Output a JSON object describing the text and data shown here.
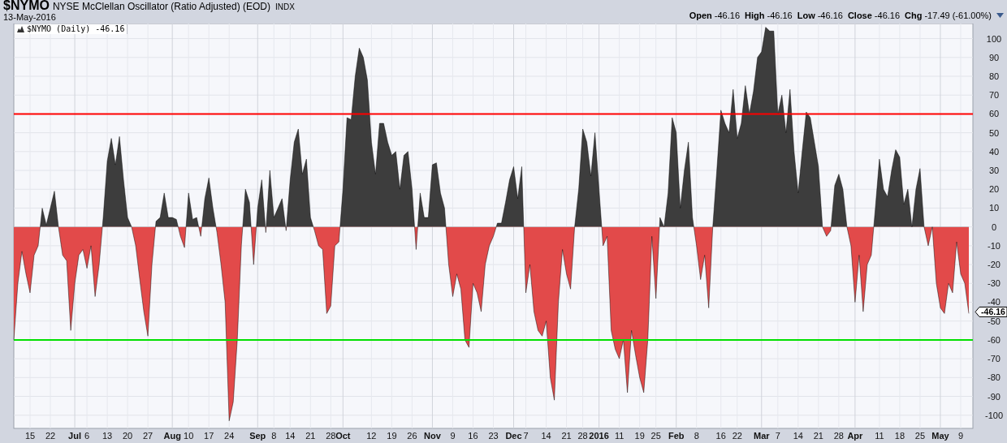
{
  "header": {
    "symbol": "$NYMO",
    "title": "NYSE McClellan Oscillator (Ratio Adjusted) (EOD)",
    "exchange": "INDX",
    "date": "13-May-2016",
    "quote": [
      {
        "label": "Open",
        "value": "-46.16"
      },
      {
        "label": "High",
        "value": "-46.16"
      },
      {
        "label": "Low",
        "value": "-46.16"
      },
      {
        "label": "Close",
        "value": "-46.16"
      },
      {
        "label": "Chg",
        "value": "-17.49 (-61.00%)"
      }
    ]
  },
  "legend": {
    "value": "-46.16"
  },
  "chart": {
    "chart_data": {
      "type": "area",
      "grid": true,
      "ylim": [
        -107,
        108
      ],
      "categories": [
        null,
        null,
        null,
        null,
        "15",
        null,
        null,
        null,
        null,
        "22",
        null,
        null,
        null,
        null,
        null,
        "Jul",
        null,
        null,
        "6",
        null,
        null,
        null,
        null,
        "13",
        null,
        null,
        null,
        null,
        "20",
        null,
        null,
        null,
        null,
        "27",
        null,
        null,
        null,
        null,
        null,
        "Aug",
        null,
        null,
        null,
        "10",
        null,
        null,
        null,
        null,
        "17",
        null,
        null,
        null,
        null,
        "24",
        null,
        null,
        null,
        null,
        null,
        null,
        "Sep",
        null,
        null,
        null,
        "8",
        null,
        null,
        null,
        "14",
        null,
        null,
        null,
        null,
        "21",
        null,
        null,
        null,
        null,
        "28",
        null,
        null,
        "Oct",
        null,
        null,
        null,
        null,
        null,
        null,
        "12",
        null,
        null,
        null,
        null,
        "19",
        null,
        null,
        null,
        null,
        "26",
        null,
        null,
        null,
        null,
        "Nov",
        null,
        null,
        null,
        null,
        "9",
        null,
        null,
        null,
        null,
        "16",
        null,
        null,
        null,
        null,
        "23",
        null,
        null,
        null,
        null,
        "Dec",
        null,
        null,
        "7",
        null,
        null,
        null,
        null,
        "14",
        null,
        null,
        null,
        null,
        "21",
        null,
        null,
        null,
        "28",
        null,
        null,
        null,
        "2016",
        null,
        null,
        null,
        null,
        "11",
        null,
        null,
        null,
        null,
        "19",
        null,
        null,
        null,
        "25",
        null,
        null,
        null,
        null,
        "Feb",
        null,
        null,
        null,
        null,
        "8",
        null,
        null,
        null,
        null,
        null,
        "16",
        null,
        null,
        null,
        "22",
        null,
        null,
        null,
        null,
        null,
        "Mar",
        null,
        null,
        null,
        "7",
        null,
        null,
        null,
        null,
        "14",
        null,
        null,
        null,
        null,
        "21",
        null,
        null,
        null,
        null,
        "28",
        null,
        null,
        null,
        "Apr",
        null,
        null,
        null,
        null,
        null,
        "11",
        null,
        null,
        null,
        null,
        "18",
        null,
        null,
        null,
        null,
        "25",
        null,
        null,
        null,
        null,
        "May",
        null,
        null,
        null,
        null,
        "9",
        null,
        null
      ],
      "yticks": [
        -100,
        -90,
        -80,
        -70,
        -60,
        -50,
        -40,
        -30,
        -20,
        -10,
        0,
        10,
        20,
        30,
        40,
        50,
        60,
        70,
        80,
        90,
        100
      ],
      "series": [
        {
          "name": "$NYMO (Daily)",
          "color": "#000000",
          "values": [
            -60,
            -30,
            -13,
            -25,
            -35,
            -15,
            -10,
            10,
            1,
            10,
            19,
            0,
            -15,
            -18,
            -55,
            -30,
            -15,
            -12,
            -22,
            -10,
            -37,
            -20,
            5,
            35,
            47,
            33,
            48,
            25,
            5,
            0,
            -10,
            -28,
            -45,
            -58,
            -20,
            3,
            5,
            18,
            5,
            5,
            4,
            -5,
            -11,
            18,
            4,
            5,
            -5,
            15,
            26,
            10,
            -3,
            -20,
            -40,
            -103,
            -93,
            -60,
            -10,
            20,
            13,
            -20,
            10,
            25,
            -3,
            30,
            5,
            10,
            15,
            -2,
            25,
            45,
            52,
            28,
            36,
            5,
            -2,
            -10,
            -12,
            -46,
            -42,
            -10,
            -8,
            20,
            58,
            57,
            80,
            95,
            90,
            78,
            45,
            28,
            55,
            55,
            45,
            38,
            40,
            20,
            38,
            40,
            20,
            -12,
            18,
            5,
            5,
            33,
            34,
            18,
            10,
            -20,
            -37,
            -25,
            -33,
            -60,
            -64,
            -30,
            -35,
            -45,
            -20,
            -10,
            -5,
            2,
            2,
            13,
            25,
            32,
            15,
            32,
            -35,
            -20,
            -45,
            -55,
            -58,
            -50,
            -80,
            -92,
            -40,
            -12,
            -25,
            -33,
            0,
            20,
            52,
            45,
            27,
            50,
            20,
            -10,
            -5,
            -55,
            -65,
            -70,
            -60,
            -88,
            -55,
            -68,
            -80,
            -88,
            -60,
            -5,
            -38,
            5,
            0,
            18,
            58,
            50,
            10,
            30,
            45,
            5,
            -10,
            -28,
            -15,
            -43,
            0,
            30,
            62,
            55,
            50,
            73,
            47,
            55,
            75,
            60,
            72,
            90,
            93,
            106,
            104,
            104,
            60,
            70,
            50,
            73,
            40,
            18,
            40,
            61,
            58,
            45,
            32,
            0,
            -5,
            -2,
            22,
            28,
            20,
            0,
            -10,
            -40,
            -15,
            -45,
            -20,
            -15,
            10,
            36,
            20,
            16,
            30,
            41,
            37,
            12,
            20,
            0,
            20,
            31,
            0,
            -10,
            0,
            -30,
            -43,
            -46,
            -30,
            -35,
            -8,
            -25,
            -30,
            -46
          ]
        }
      ],
      "ref_lines": [
        {
          "axis": "y",
          "value": 60,
          "color": "#ff0000"
        },
        {
          "axis": "y",
          "value": -60,
          "color": "#00e000"
        }
      ],
      "annotations": [
        "-46.16"
      ]
    }
  }
}
